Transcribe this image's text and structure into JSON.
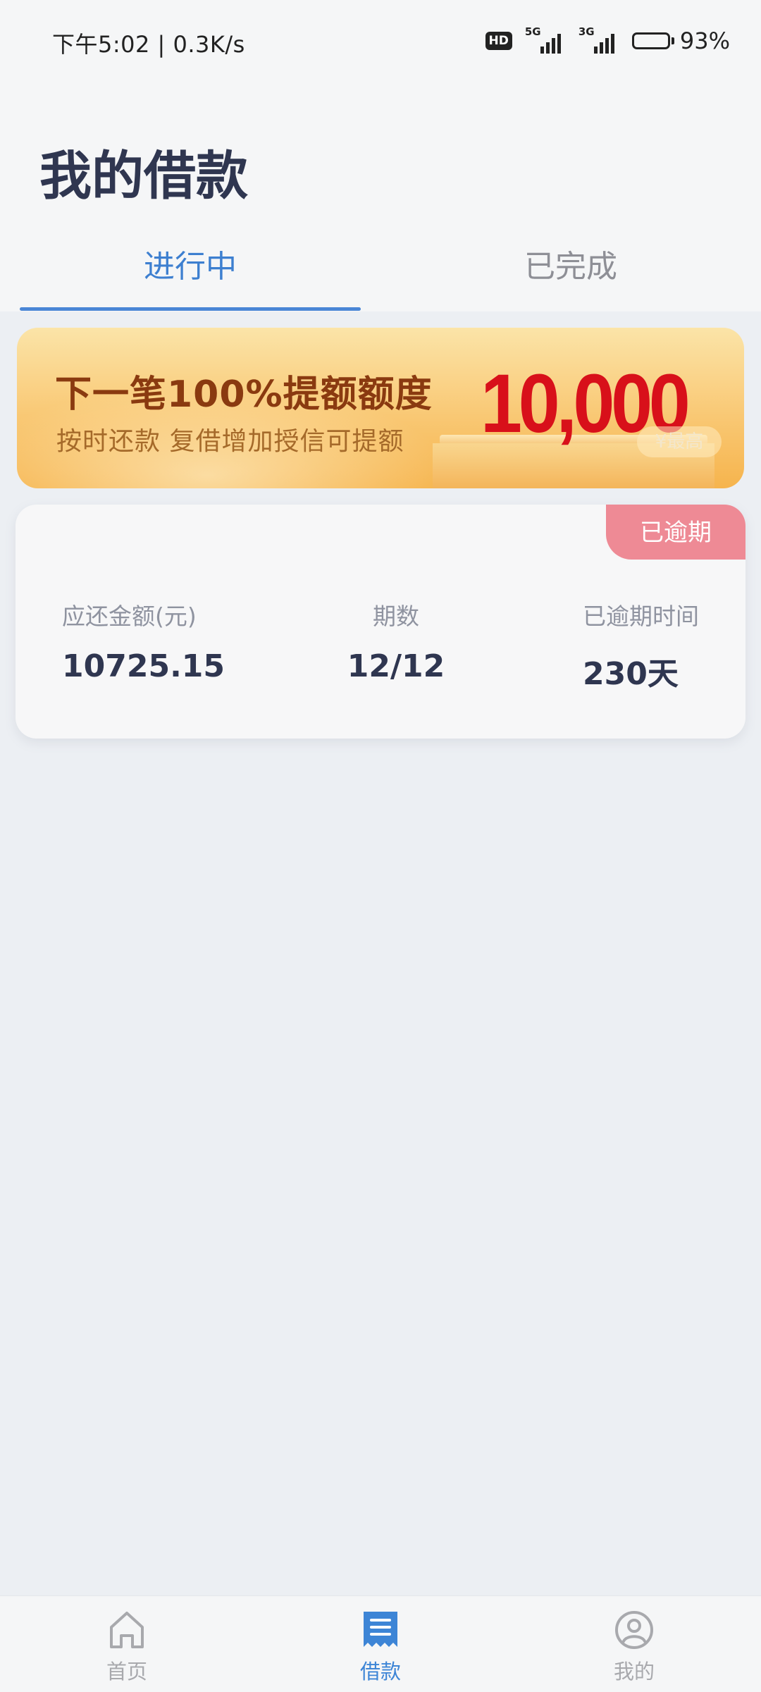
{
  "status_bar": {
    "time_speed": "下午5:02 | 0.3K/s",
    "hd": "HD",
    "network_1": "5G",
    "network_2": "3G",
    "battery_level": 0.93,
    "battery_text": "93%"
  },
  "header": {
    "title": "我的借款"
  },
  "tabs": [
    {
      "label": "进行中",
      "active": true
    },
    {
      "label": "已完成",
      "active": false
    }
  ],
  "banner": {
    "title": "下一笔100%提额额度",
    "subtitle": "按时还款  复借增加授信可提额",
    "amount": "10,000",
    "max_label": "¥最高"
  },
  "loan": {
    "status_badge": "已逾期",
    "amount_label": "应还金额(元)",
    "amount_value": "10725.15",
    "periods_label": "期数",
    "periods_value": "12/12",
    "overdue_label": "已逾期时间",
    "overdue_value": "230天"
  },
  "bottom_nav": [
    {
      "label": "首页",
      "icon": "home-icon",
      "active": false
    },
    {
      "label": "借款",
      "icon": "loan-document-icon",
      "active": true
    },
    {
      "label": "我的",
      "icon": "user-profile-icon",
      "active": false
    }
  ],
  "colors": {
    "accent": "#3d7fd0",
    "title": "#2f3650",
    "overdue_badge": "#ee8a95",
    "banner_amount": "#d8101a"
  }
}
